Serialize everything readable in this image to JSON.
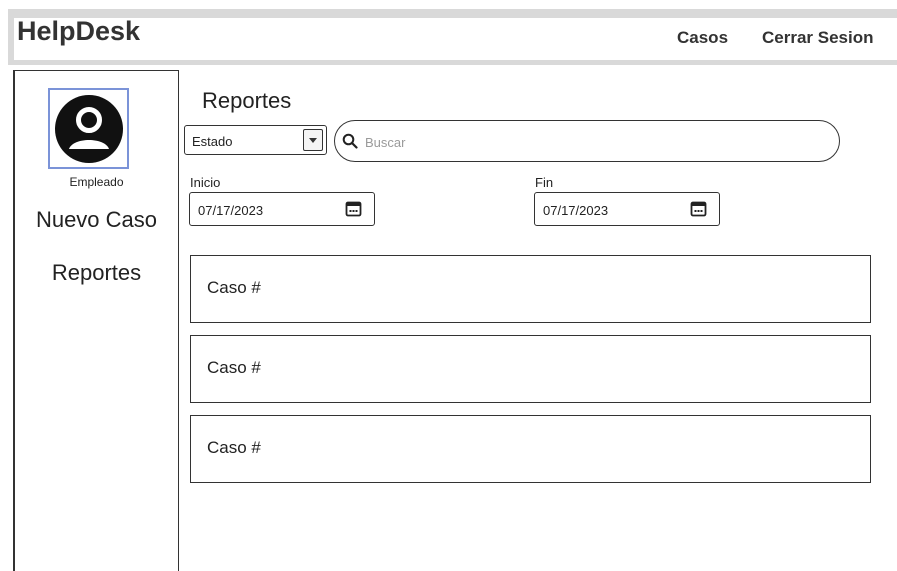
{
  "header": {
    "brand": "HelpDesk",
    "nav": {
      "casos": "Casos",
      "logout": "Cerrar Sesion"
    }
  },
  "sidebar": {
    "avatar_label": "Empleado",
    "items": [
      {
        "label": "Nuevo Caso"
      },
      {
        "label": "Reportes"
      }
    ]
  },
  "main": {
    "title": "Reportes",
    "filter": {
      "estado_value": "Estado",
      "search_placeholder": "Buscar"
    },
    "dates": {
      "inicio_label": "Inicio",
      "inicio_value": "07/17/2023",
      "fin_label": "Fin",
      "fin_value": "07/17/2023"
    },
    "cases": [
      {
        "label": "Caso #"
      },
      {
        "label": "Caso #"
      },
      {
        "label": "Caso #"
      }
    ]
  },
  "icons": {
    "avatar": "user-circle-icon",
    "select_arrow": "caret-down-icon",
    "search": "search-icon",
    "calendar": "calendar-icon"
  }
}
